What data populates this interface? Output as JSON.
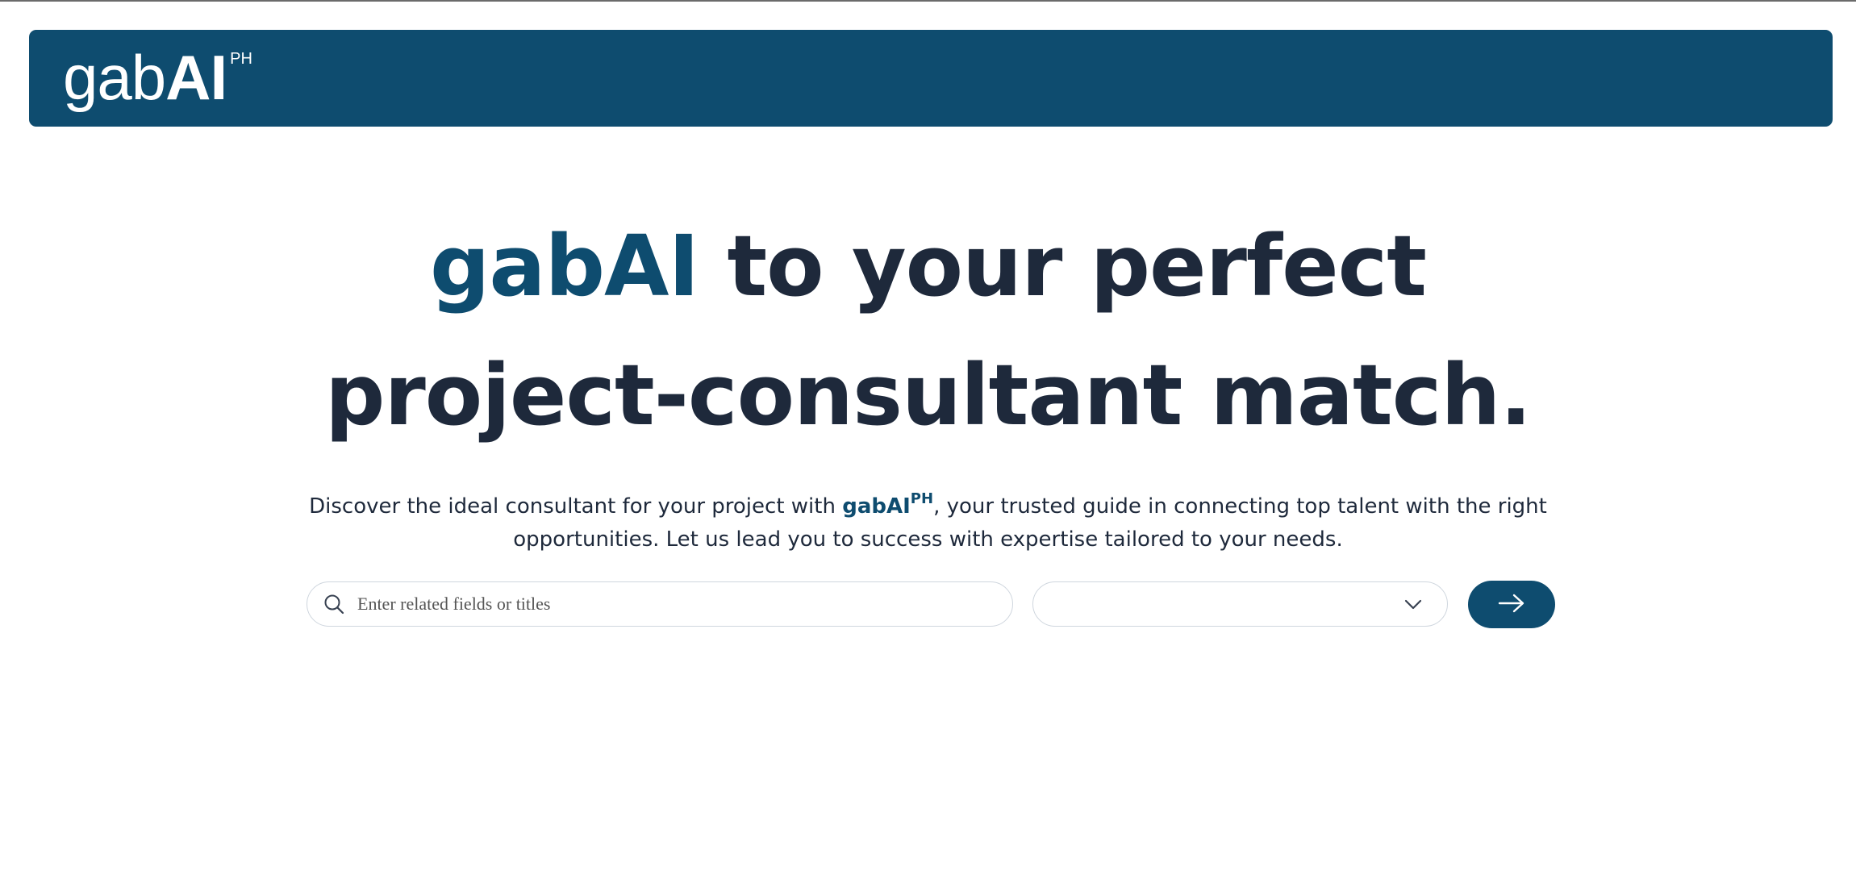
{
  "header": {
    "logo": {
      "gab": "gab",
      "ai": "AI",
      "sup": "PH"
    }
  },
  "hero": {
    "headline_brand": "gabAI",
    "headline_line1_rest": " to your perfect",
    "headline_line2": "project-consultant match.",
    "sub_before": "Discover the ideal consultant for your project with ",
    "sub_brand": "gabAI",
    "sub_brand_sup": "PH",
    "sub_after_line1": ", your trusted guide in connecting top talent with the right",
    "sub_line2": "opportunities. Let us lead you to success with expertise tailored to your needs."
  },
  "search": {
    "placeholder": "Enter related fields or titles",
    "value": "",
    "icon": "search-icon"
  },
  "filter_select": {
    "selected": "",
    "icon": "chevron-down-icon"
  },
  "submit_button": {
    "icon": "arrow-right-icon"
  },
  "colors": {
    "brand": "#0e4c6f",
    "text": "#1e293b",
    "border": "#cfd6de",
    "background": "#ffffff"
  }
}
